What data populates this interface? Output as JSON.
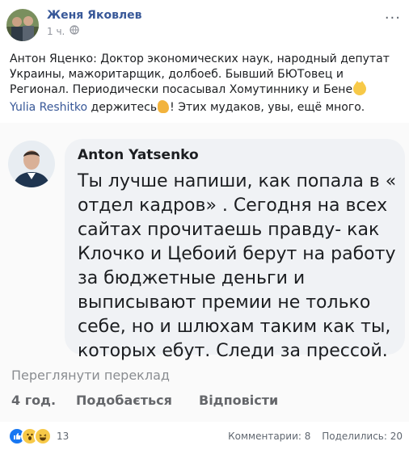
{
  "post": {
    "author": "Женя Яковлев",
    "time": "1 ч.",
    "more": "···",
    "text": "Антон Яценко: Доктор экономических наук, народный депутат Украины, мажоритарщик, долбоеб. Бывший БЮТовец и Регионал. Периодически посасывал Хомутиннику и Бене",
    "mention_name": "Yulia Reshitko",
    "mention_text1": " держитесь",
    "mention_text2": "! Этих мудаков, увы, ещё много."
  },
  "comment": {
    "name": "Anton  Yatsenko",
    "text": "Ты лучше напиши, как попала в « отдел кадров» . Сегодня на всех сайтах прочитаешь правду- как Клочко и Цебоий берут на работу за бюджетные деньги и выписывают премии не только себе, но и шлюхам таким как ты, которых ебут. Следи за прессой.",
    "translate": "Переглянути переклад",
    "age": "4 год.",
    "like": "Подобається",
    "reply": "Відповісти"
  },
  "footer": {
    "reaction_count": "13",
    "comments": "Комментарии: 8",
    "shares": "Поделились: 20"
  },
  "icons": {
    "globe": "globe-icon",
    "like_reaction": "like-reaction-icon",
    "wow_reaction": "wow-reaction-icon",
    "haha_reaction": "haha-reaction-icon",
    "cat_emoji": "smiling-cat-emoji",
    "flexed_biceps_emoji": "flexed-biceps-emoji"
  },
  "colors": {
    "link": "#385898",
    "muted": "#90949c",
    "like_blue": "#1877f2",
    "bubble": "#f0f2f5"
  }
}
